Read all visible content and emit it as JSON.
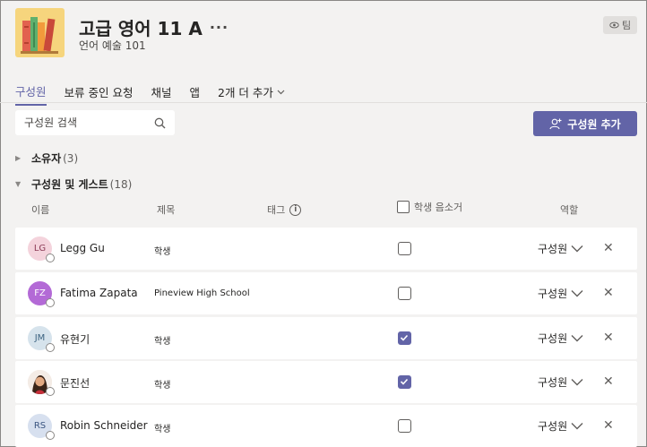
{
  "header": {
    "team_name": "고급 영어 11 A",
    "more": "···",
    "subtitle": "언어 예술 101",
    "badge": "팀"
  },
  "tabs": [
    {
      "label": "구성원",
      "active": true
    },
    {
      "label": "보류 중인 요청"
    },
    {
      "label": "채널"
    },
    {
      "label": "앱"
    },
    {
      "label": "2개 더 추가"
    }
  ],
  "search": {
    "placeholder": "구성원 검색"
  },
  "add_button": {
    "label": "구성원 추가"
  },
  "owners": {
    "label": "소유자",
    "count": "(3)"
  },
  "members": {
    "label": "구성원 및 게스트",
    "count": "(18)"
  },
  "columns": {
    "name": "이름",
    "title": "제목",
    "tags": "태그",
    "mute": "학생 음소거",
    "role": "역할"
  },
  "rows": [
    {
      "initials": "LG",
      "name": "Legg Gu",
      "title": "학생",
      "muted": false,
      "role": "구성원",
      "avatar_bg": "#f4d3dc",
      "avatar_fg": "#8b3a56"
    },
    {
      "initials": "FZ",
      "name": "Fatima Zapata",
      "title": "Pineview High School",
      "muted": false,
      "role": "구성원",
      "avatar_bg": "#b36ad6",
      "avatar_fg": "#ffffff"
    },
    {
      "initials": "JM",
      "name": "유현기",
      "title": "학생",
      "muted": true,
      "role": "구성원",
      "avatar_bg": "#d6e3ec",
      "avatar_fg": "#3c6380"
    },
    {
      "initials": "",
      "name": "문진선",
      "title": "학생",
      "muted": true,
      "role": "구성원",
      "avatar_bg": "#8a5a3c",
      "avatar_fg": "#ffffff"
    },
    {
      "initials": "RS",
      "name": "Robin Schneider",
      "title": "학생",
      "muted": false,
      "role": "구성원",
      "avatar_bg": "#d7e0ef",
      "avatar_fg": "#3b5580"
    }
  ],
  "colors": {
    "accent": "#6264a7",
    "page_bg": "#f3f2f1"
  }
}
